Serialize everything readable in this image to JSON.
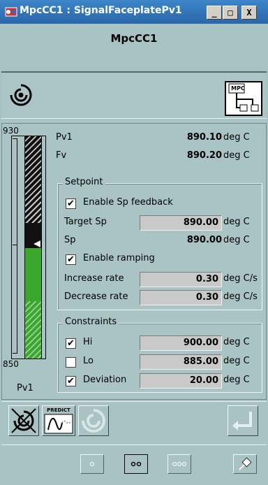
{
  "window": {
    "title": "MpcCC1 : SignalFaceplatePv1",
    "min_label": "_",
    "max_label": "□",
    "close_label": "X"
  },
  "header": {
    "title": "MpcCC1"
  },
  "mpc_icon_label": "MPC",
  "bar": {
    "scale_max": "930",
    "scale_min": "850",
    "caption": "Pv1"
  },
  "readouts": [
    {
      "label": "Pv1",
      "value": "890.10",
      "unit": "deg C"
    },
    {
      "label": "Fv",
      "value": "890.20",
      "unit": "deg C"
    }
  ],
  "setpoint": {
    "title": "Setpoint",
    "enable_sp_feedback": {
      "label": "Enable Sp feedback",
      "checked": true
    },
    "target_sp": {
      "label": "Target Sp",
      "value": "890.00",
      "unit": "deg C"
    },
    "sp": {
      "label": "Sp",
      "value": "890.00",
      "unit": "deg C"
    },
    "enable_ramping": {
      "label": "Enable ramping",
      "checked": true
    },
    "increase_rate": {
      "label": "Increase rate",
      "value": "0.30",
      "unit": "deg C/s"
    },
    "decrease_rate": {
      "label": "Decrease rate",
      "value": "0.30",
      "unit": "deg C/s"
    }
  },
  "constraints": {
    "title": "Constraints",
    "rows": [
      {
        "label": "Hi",
        "checked": true,
        "value": "900.00",
        "unit": "deg C"
      },
      {
        "label": "Lo",
        "checked": false,
        "value": "885.00",
        "unit": "deg C"
      },
      {
        "label": "Deviation",
        "checked": true,
        "value": "20.00",
        "unit": "deg C"
      }
    ]
  },
  "predict_label": "PREDICT",
  "check_mark": "✔",
  "icons": [
    "app-icon",
    "signal-swirl-icon",
    "mpc-block-icon",
    "disable-signal-icon",
    "predict-icon",
    "swirl-button-icon",
    "enter-arrow-icon",
    "one-dot-icon",
    "two-dots-icon",
    "three-dots-icon",
    "pin-icon"
  ],
  "colors": {
    "accent_blue": "#2a66aa",
    "background": "#a9c3c4",
    "green": "#3aa82c"
  }
}
